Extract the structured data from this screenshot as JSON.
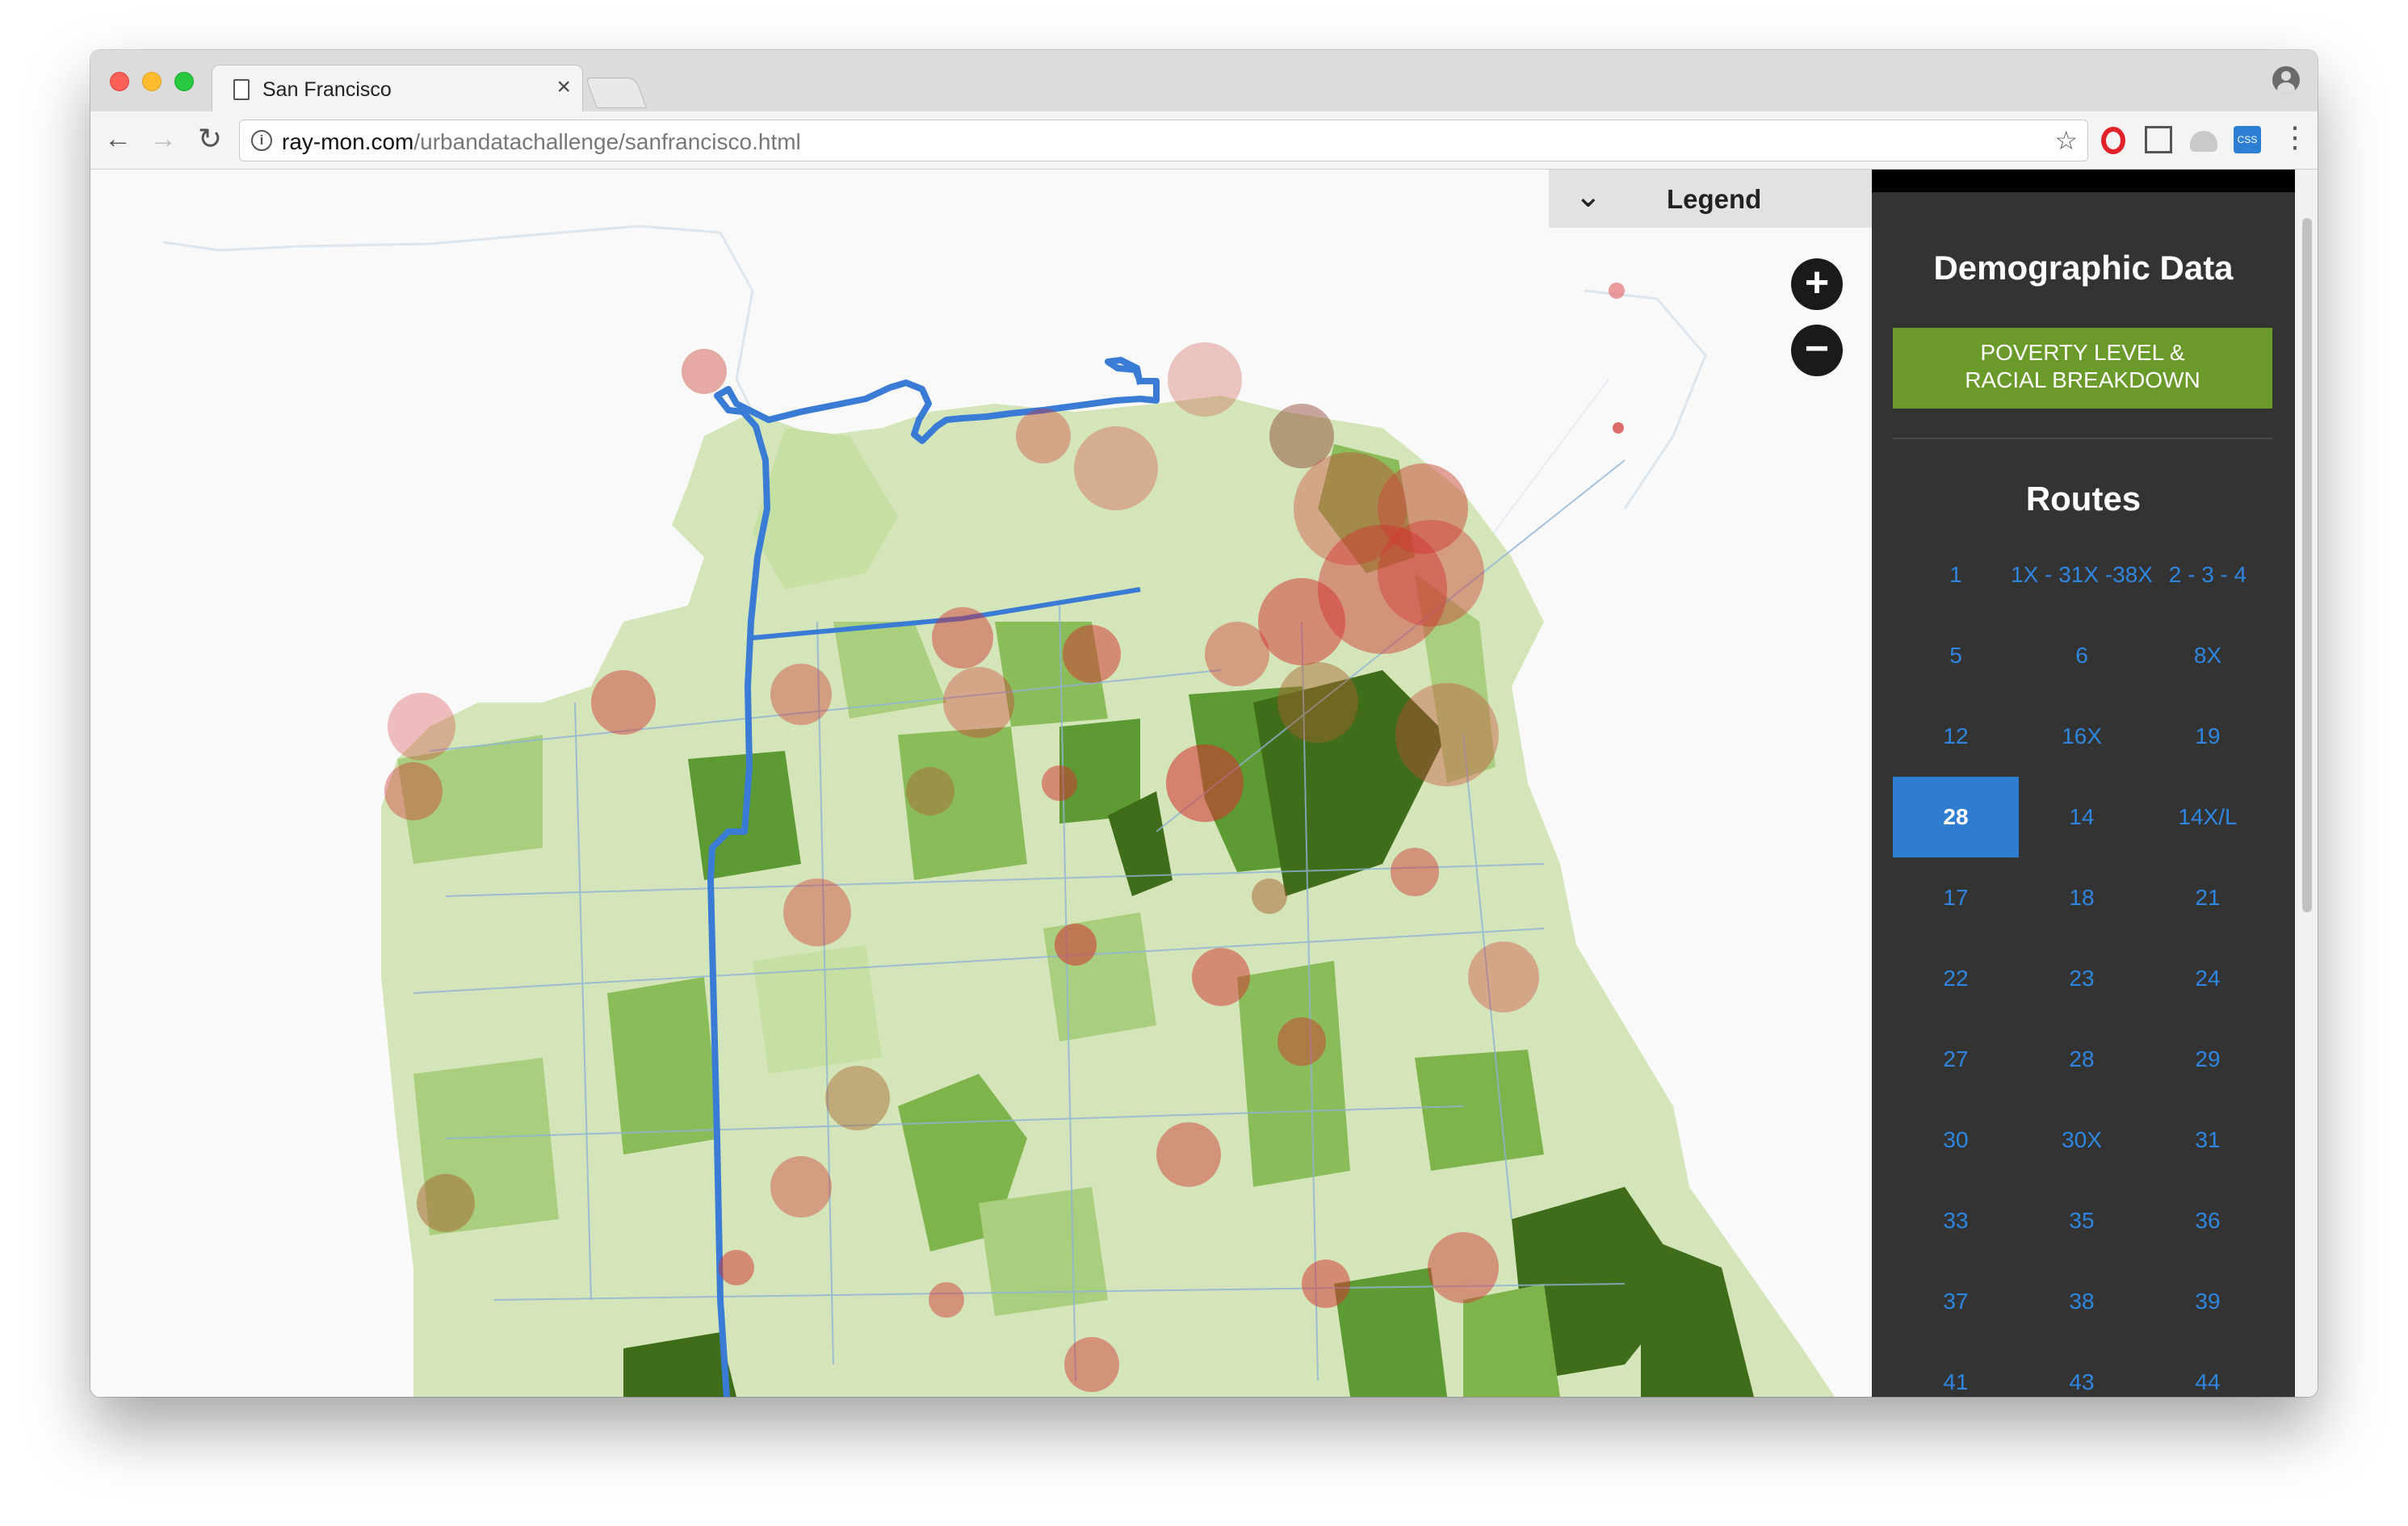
{
  "tab": {
    "title": "San Francisco",
    "close": "×"
  },
  "address": {
    "host": "ray-mon.com",
    "path": "/urbandatachallenge/sanfrancisco.html"
  },
  "legend": {
    "label": "Legend"
  },
  "zoom": {
    "in": "+",
    "out": "−"
  },
  "sidebar": {
    "demographic_title": "Demographic Data",
    "poverty_button": "POVERTY LEVEL &\nRACIAL BREAKDOWN",
    "routes_title": "Routes",
    "routes": [
      {
        "label": "1"
      },
      {
        "label": "1X - 31X -38X"
      },
      {
        "label": "2 - 3 - 4"
      },
      {
        "label": "5"
      },
      {
        "label": "6"
      },
      {
        "label": "8X"
      },
      {
        "label": "12"
      },
      {
        "label": "16X"
      },
      {
        "label": "19"
      },
      {
        "label": "28",
        "active": true
      },
      {
        "label": "14"
      },
      {
        "label": "14X/L"
      },
      {
        "label": "17"
      },
      {
        "label": "18"
      },
      {
        "label": "21"
      },
      {
        "label": "22"
      },
      {
        "label": "23"
      },
      {
        "label": "24"
      },
      {
        "label": "27"
      },
      {
        "label": "28"
      },
      {
        "label": "29"
      },
      {
        "label": "30"
      },
      {
        "label": "30X"
      },
      {
        "label": "31"
      },
      {
        "label": "33"
      },
      {
        "label": "35"
      },
      {
        "label": "36"
      },
      {
        "label": "37"
      },
      {
        "label": "38"
      },
      {
        "label": "39"
      },
      {
        "label": "41"
      },
      {
        "label": "43"
      },
      {
        "label": "44"
      }
    ]
  },
  "colors": {
    "accent": "#2f86e0",
    "poverty_green": "#6a9a2a",
    "sidebar_bg": "#333333",
    "route_line": "#3a7bd5",
    "ridership_red": "#d32f2f"
  }
}
